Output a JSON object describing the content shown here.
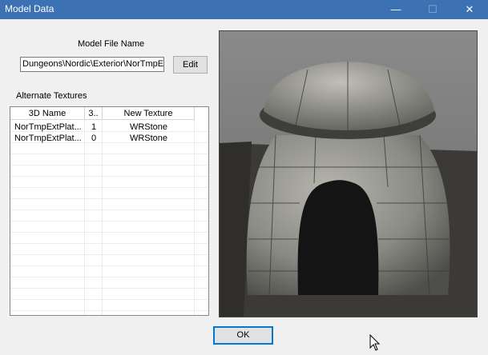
{
  "window": {
    "title": "Model Data",
    "minimize_icon": "minimize-icon",
    "maximize_icon": "maximize-icon",
    "close_icon": "close-icon"
  },
  "model_file": {
    "label": "Model File Name",
    "value": "Dungeons\\Nordic\\Exterior\\NorTmpE:",
    "edit_label": "Edit"
  },
  "textures": {
    "label": "Alternate Textures",
    "columns": [
      "3D Name",
      "3..",
      "New Texture"
    ],
    "rows": [
      {
        "name": "NorTmpExtPlat...",
        "index": "1",
        "texture": "WRStone"
      },
      {
        "name": "NorTmpExtPlat...",
        "index": "0",
        "texture": "WRStone"
      }
    ]
  },
  "ok_label": "OK",
  "colors": {
    "titlebar": "#3c72b3",
    "dialog_bg": "#f0f0f0"
  }
}
